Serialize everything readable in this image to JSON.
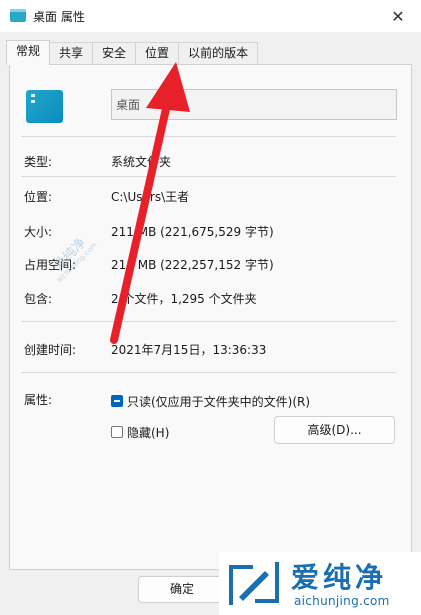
{
  "window": {
    "title": "桌面 属性",
    "close_glyph": "✕"
  },
  "tabs": [
    {
      "label": "常规",
      "active": true
    },
    {
      "label": "共享",
      "active": false
    },
    {
      "label": "安全",
      "active": false
    },
    {
      "label": "位置",
      "active": false
    },
    {
      "label": "以前的版本",
      "active": false
    }
  ],
  "general": {
    "name_value": "桌面",
    "rows": {
      "type": {
        "label": "类型:",
        "value": "系统文件夹"
      },
      "location": {
        "label": "位置:",
        "value": "C:\\Users\\王者"
      },
      "size": {
        "label": "大小:",
        "value": "211 MB (221,675,529 字节)"
      },
      "size_on_disk": {
        "label": "占用空间:",
        "value": "211 MB (222,257,152 字节)"
      },
      "contains": {
        "label": "包含:",
        "value": "2 个文件，1,295 个文件夹"
      },
      "created": {
        "label": "创建时间:",
        "value": "2021年7月15日，13:36:33"
      }
    },
    "attributes": {
      "label": "属性:",
      "readonly_label": "只读(仅应用于文件夹中的文件)(R)",
      "readonly_state": "indeterminate",
      "hidden_label": "隐藏(H)",
      "hidden_state": "unchecked",
      "advanced_button": "高级(D)..."
    }
  },
  "footer": {
    "ok_button": "确定"
  },
  "annotation": {
    "arrow_color": "#e8202a"
  },
  "watermark": {
    "cn": "爱纯净",
    "en": "aichunjing.com",
    "faint_cn": "爱纯净",
    "faint_en": "aichunjing.com"
  }
}
